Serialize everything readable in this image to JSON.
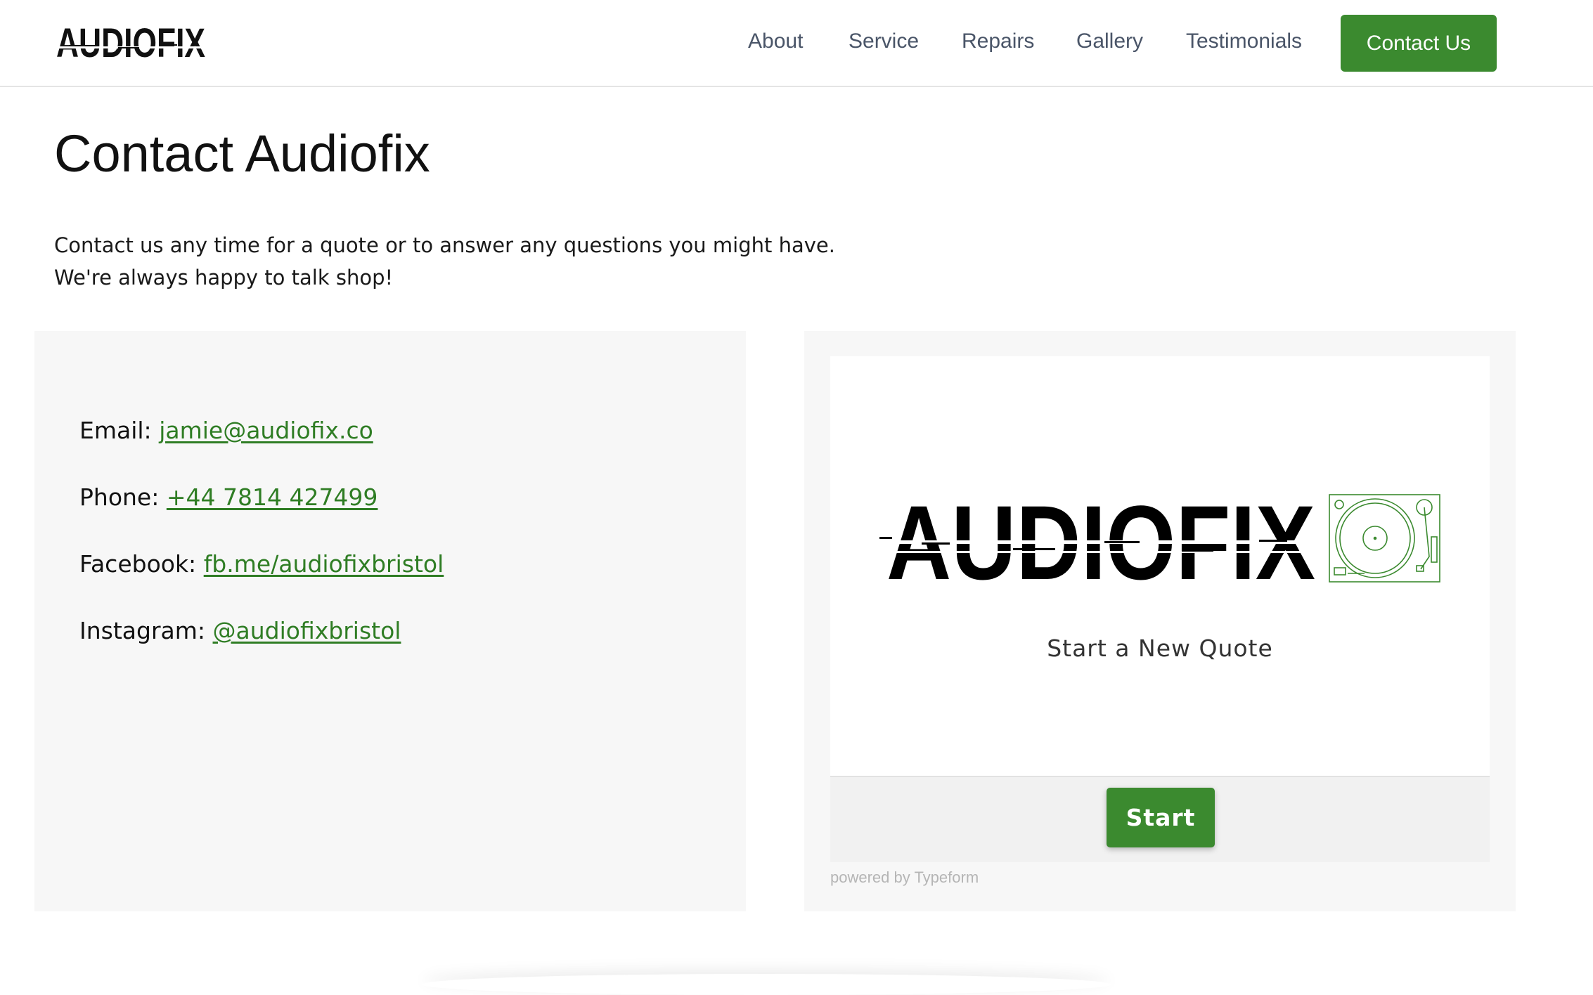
{
  "header": {
    "logo_text": "AUDIOFIX",
    "nav": [
      "About",
      "Service",
      "Repairs",
      "Gallery",
      "Testimonials"
    ],
    "cta_label": "Contact Us",
    "accent_color": "#3b8a2f"
  },
  "main": {
    "title": "Contact Audiofix",
    "intro": "Contact us any time for a quote or to answer any questions you might have. We're always happy to talk shop!"
  },
  "contact": {
    "email_label": "Email:",
    "email_value": "jamie@audiofix.co",
    "phone_label": "Phone:",
    "phone_value": "+44 7814 427499",
    "facebook_label": "Facebook:",
    "facebook_value": "fb.me/audiofixbristol",
    "instagram_label": "Instagram:",
    "instagram_value": "@audiofixbristol",
    "link_color": "#2f7d24"
  },
  "form": {
    "logo_text": "AUDIOFIX",
    "logo_icon": "turntable-icon",
    "subtitle": "Start a New Quote",
    "start_label": "Start",
    "powered_by": "powered by Typeform"
  }
}
